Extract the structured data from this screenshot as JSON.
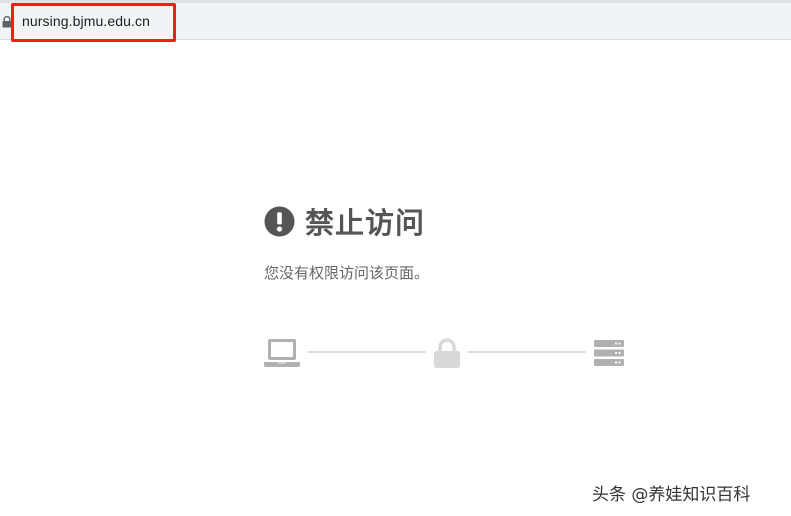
{
  "browser": {
    "url": "nursing.bjmu.edu.cn"
  },
  "error": {
    "title": "禁止访问",
    "description": "您没有权限访问该页面。"
  },
  "diagram": {
    "icons": [
      "laptop-icon",
      "lock-icon",
      "server-icon"
    ],
    "icon_color": "#b0b0b0",
    "lock_color": "#d8d8d8"
  },
  "watermark": {
    "text": "头条 @养娃知识百科"
  },
  "colors": {
    "highlight": "#ff1a1a",
    "title": "#555555",
    "text": "#666666"
  }
}
